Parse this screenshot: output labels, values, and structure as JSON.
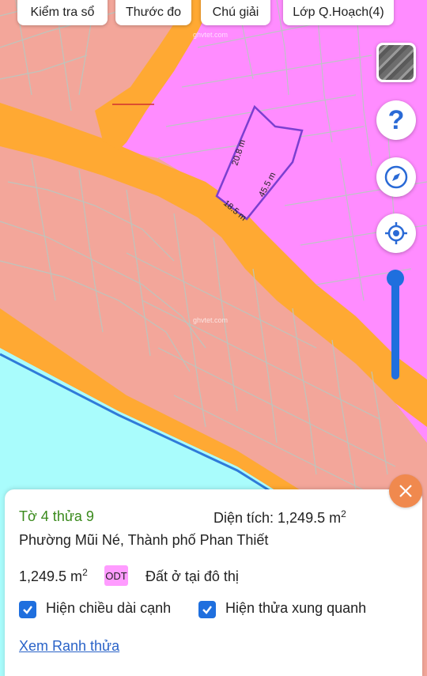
{
  "toolbar": {
    "check_book": "Kiểm tra sổ",
    "ruler": "Thước đo",
    "legend": "Chú giải",
    "planning_layer": "Lớp Q.Hoạch(4)"
  },
  "map": {
    "watermark_1": "ghvtet.com",
    "watermark_2": "ghvtet.com",
    "edge_top": "20.8 m",
    "edge_right": "45.5 m",
    "edge_bottom": "18.5 m",
    "colors": {
      "residential_pink": "#f3a69a",
      "commercial_magenta": "#ff8cff",
      "road_orange": "#ffa933",
      "water_cyan": "#a9fcfc",
      "parcel_outline": "#7b3fd0",
      "boundary_blue": "#2f7bd9"
    }
  },
  "controls": {
    "help_glyph": "?"
  },
  "panel": {
    "parcel_title": "Tờ 4 thửa 9",
    "area_label": "Diện tích: 1,249.5 m",
    "area_unit_sup": "2",
    "address": "Phường Mũi Né, Thành phố Phan Thiết",
    "area_value": "1,249.5 m",
    "area_value_sup": "2",
    "land_code": "ODT",
    "land_type": "Đất ở tại đô thị",
    "show_edge_length": "Hiện chiều dài cạnh",
    "show_neighbors": "Hiện thửa xung quanh",
    "view_boundary": "Xem Ranh thửa"
  }
}
